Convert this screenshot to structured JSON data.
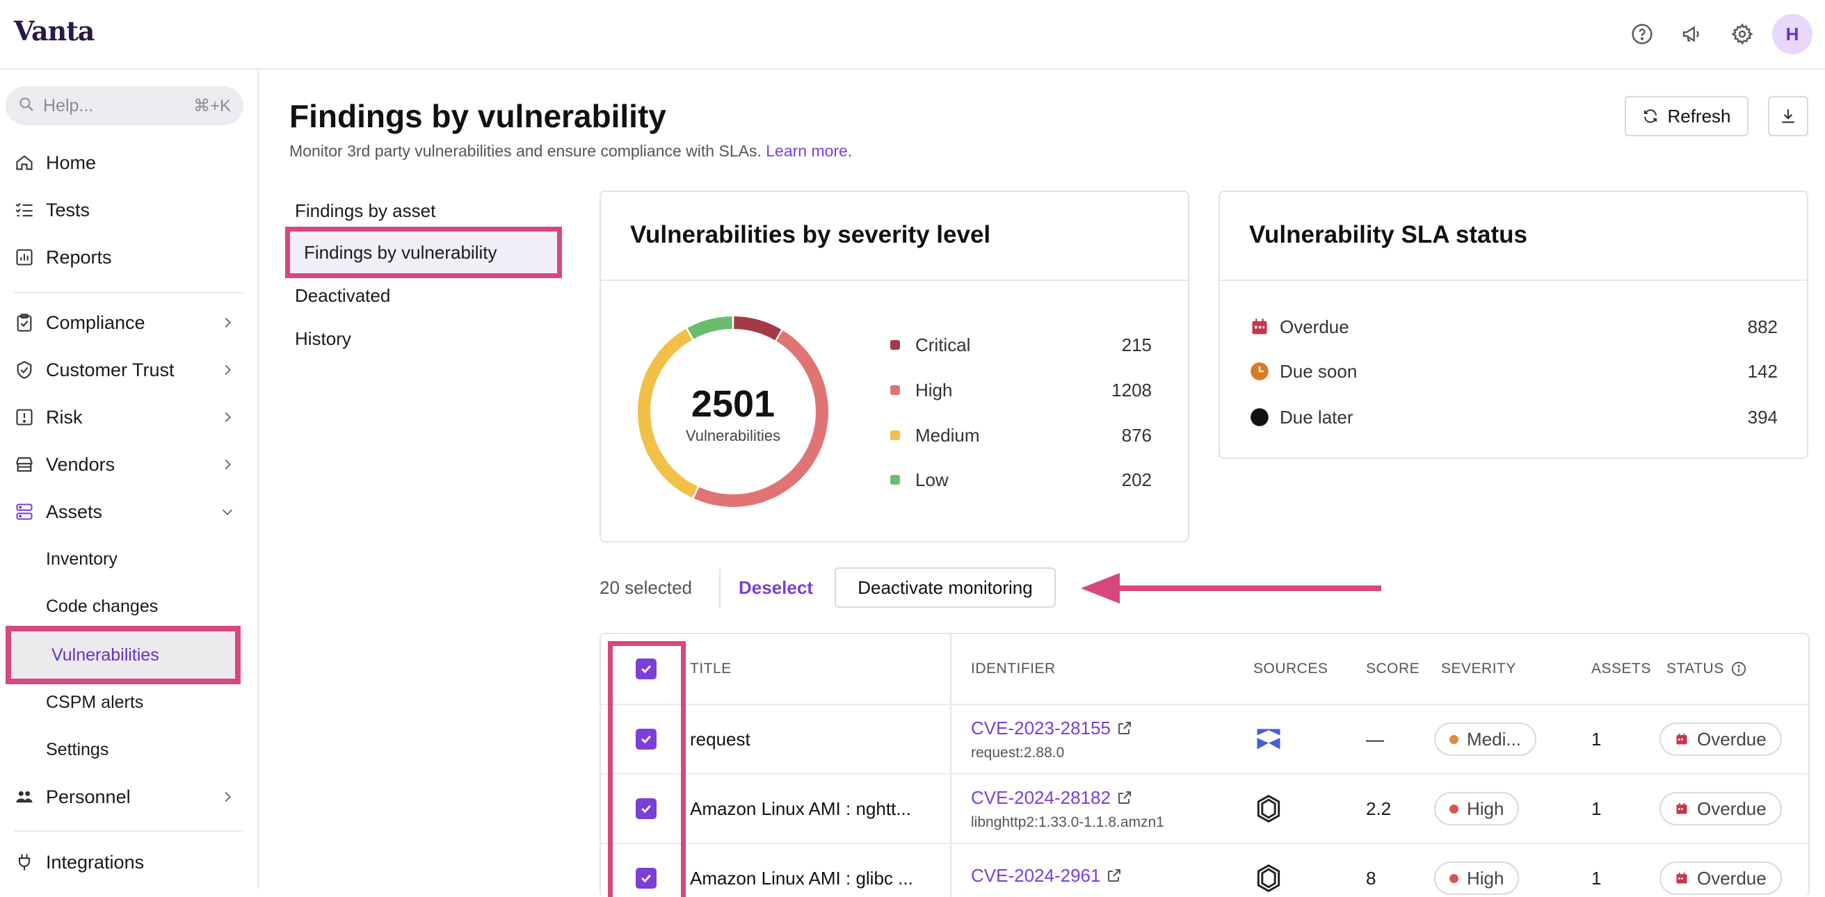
{
  "header": {
    "logo": "Vanta",
    "avatar_initial": "H"
  },
  "sidebar": {
    "search_placeholder": "Help...",
    "search_shortcut": "⌘+K",
    "items": [
      {
        "label": "Home"
      },
      {
        "label": "Tests"
      },
      {
        "label": "Reports"
      },
      {
        "label": "Compliance"
      },
      {
        "label": "Customer Trust"
      },
      {
        "label": "Risk"
      },
      {
        "label": "Vendors"
      },
      {
        "label": "Assets"
      },
      {
        "label": "Personnel"
      },
      {
        "label": "Integrations"
      }
    ],
    "asset_subitems": [
      {
        "label": "Inventory"
      },
      {
        "label": "Code changes"
      },
      {
        "label": "Vulnerabilities"
      },
      {
        "label": "CSPM alerts"
      },
      {
        "label": "Settings"
      }
    ]
  },
  "page": {
    "title": "Findings by vulnerability",
    "subtitle": "Monitor 3rd party vulnerabilities and ensure compliance with SLAs.",
    "learn_more": "Learn more",
    "subtitle_end": ".",
    "refresh_label": "Refresh"
  },
  "subnav": [
    {
      "label": "Findings by asset"
    },
    {
      "label": "Findings by vulnerability"
    },
    {
      "label": "Deactivated"
    },
    {
      "label": "History"
    }
  ],
  "severity_card": {
    "title": "Vulnerabilities by severity level",
    "total": "2501",
    "total_label": "Vulnerabilities",
    "levels": [
      {
        "name": "Critical",
        "value": 215,
        "color": "#a33a48"
      },
      {
        "name": "High",
        "value": 1208,
        "color": "#e07474"
      },
      {
        "name": "Medium",
        "value": 876,
        "color": "#f2bf47"
      },
      {
        "name": "Low",
        "value": 202,
        "color": "#6bbd6e"
      }
    ]
  },
  "sla_card": {
    "title": "Vulnerability SLA status",
    "items": [
      {
        "name": "Overdue",
        "value": "882",
        "color": "#c9364a",
        "icon": "calendar-icon"
      },
      {
        "name": "Due soon",
        "value": "142",
        "color": "#d97a2b",
        "icon": "clock-icon"
      },
      {
        "name": "Due later",
        "value": "394",
        "color": "#111111",
        "icon": "circle-icon"
      }
    ]
  },
  "selection": {
    "count_text": "20 selected",
    "deselect": "Deselect",
    "deactivate": "Deactivate monitoring"
  },
  "table": {
    "headers": {
      "title": "TITLE",
      "identifier": "IDENTIFIER",
      "sources": "SOURCES",
      "score": "SCORE",
      "severity": "SEVERITY",
      "assets": "ASSETS",
      "status": "STATUS"
    },
    "rows": [
      {
        "title": "request",
        "cve": "CVE-2023-28155",
        "package": "request:2.88.0",
        "source": "snyk-icon",
        "score": "—",
        "severity": "Medi...",
        "severity_color": "#e08a3a",
        "assets": "1",
        "status": "Overdue"
      },
      {
        "title": "Amazon Linux AMI : nghtt...",
        "cve": "CVE-2024-28182",
        "package": "libnghttp2:1.33.0-1.1.8.amzn1",
        "source": "inspector-icon",
        "score": "2.2",
        "severity": "High",
        "severity_color": "#d9534f",
        "assets": "1",
        "status": "Overdue"
      },
      {
        "title": "Amazon Linux AMI : glibc ...",
        "cve": "CVE-2024-2961",
        "package": "",
        "source": "inspector-icon",
        "score": "8",
        "severity": "High",
        "severity_color": "#d9534f",
        "assets": "1",
        "status": "Overdue"
      }
    ]
  }
}
